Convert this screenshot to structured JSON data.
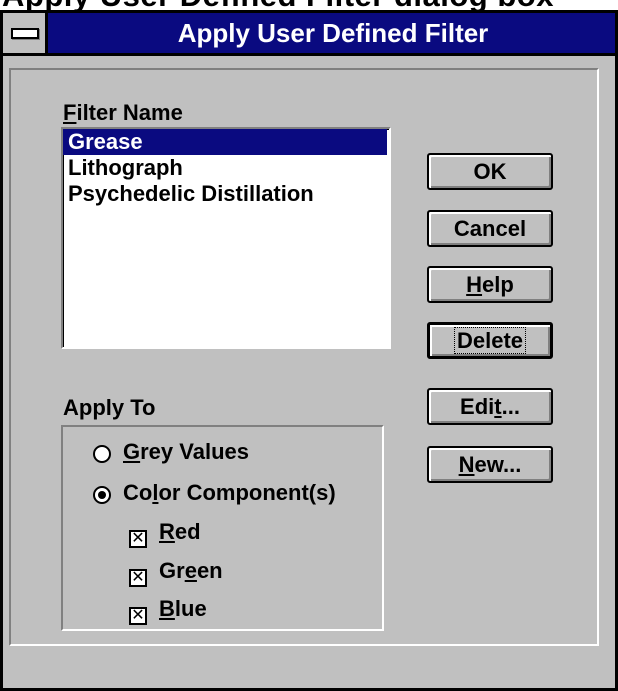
{
  "caption_top": "Apply User Defined Filter dialog box",
  "window": {
    "title": "Apply User Defined Filter"
  },
  "filter_name": {
    "label_accel": "F",
    "label_rest": "ilter Name",
    "items": [
      "Grease",
      "Lithograph",
      "Psychedelic Distillation"
    ],
    "selected": "Grease"
  },
  "buttons": {
    "ok": "OK",
    "cancel": "Cancel",
    "help_accel": "H",
    "help_rest": "elp",
    "delete": "Delete",
    "edit_pre": "Edi",
    "edit_accel": "t",
    "edit_post": "...",
    "new_accel": "N",
    "new_rest": "ew..."
  },
  "apply_to": {
    "label": "Apply To",
    "grey_accel": "G",
    "grey_rest": "rey Values",
    "color_pre": "Co",
    "color_accel": "l",
    "color_post": "or Component(s)",
    "red_accel": "R",
    "red_rest": "ed",
    "green_pre": "Gr",
    "green_accel": "e",
    "green_post": "en",
    "blue_accel": "B",
    "blue_rest": "lue",
    "grey_checked": false,
    "color_checked": true,
    "red_checked": true,
    "green_checked": true,
    "blue_checked": true
  },
  "colors": {
    "titlebar": "#0a0a80",
    "face": "#c0c0c0",
    "selection": "#0a0a80"
  }
}
